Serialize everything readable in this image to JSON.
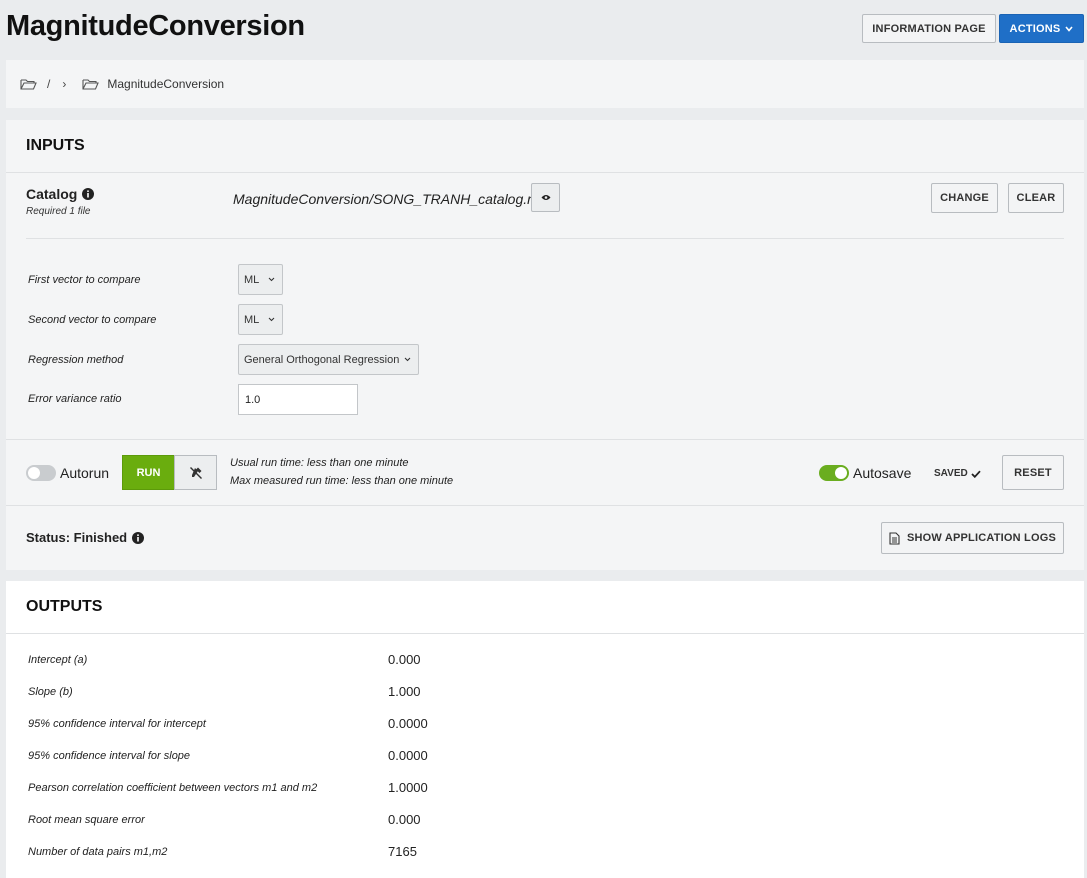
{
  "header": {
    "title": "MagnitudeConversion",
    "info_button": "INFORMATION PAGE",
    "actions_button": "ACTIONS"
  },
  "breadcrumb": {
    "root_sep": "/",
    "chevron": "›",
    "current": "MagnitudeConversion"
  },
  "inputs": {
    "title": "INPUTS",
    "catalog": {
      "label": "Catalog",
      "required": "Required 1 file",
      "path": "MagnitudeConversion/SONG_TRANH_catalog.mat",
      "change_button": "CHANGE",
      "clear_button": "CLEAR"
    },
    "params": [
      {
        "label": "First vector to compare",
        "value": "ML"
      },
      {
        "label": "Second vector to compare",
        "value": "ML"
      },
      {
        "label": "Regression method",
        "value": "General Orthogonal Regression"
      },
      {
        "label": "Error variance ratio",
        "value": "1.0"
      }
    ],
    "run": {
      "autorun_label": "Autorun",
      "autorun_on": false,
      "run_button": "RUN",
      "usual_time": "Usual run time: less than one minute",
      "max_time": "Max measured run time: less than one minute",
      "autosave_label": "Autosave",
      "autosave_on": true,
      "saved_label": "SAVED",
      "reset_button": "RESET"
    },
    "status": {
      "text": "Status: Finished",
      "logs_button": "SHOW APPLICATION LOGS"
    }
  },
  "outputs": {
    "title": "OUTPUTS",
    "rows": [
      {
        "label": "Intercept (a)",
        "value": "0.000"
      },
      {
        "label": "Slope (b)",
        "value": "1.000"
      },
      {
        "label": "95% confidence interval for intercept",
        "value": "0.0000"
      },
      {
        "label": "95% confidence interval for slope",
        "value": "0.0000"
      },
      {
        "label": "Pearson correlation coefficient between vectors m1 and m2",
        "value": "1.0000"
      },
      {
        "label": "Root mean square error",
        "value": "0.000"
      },
      {
        "label": "Number of data pairs m1,m2",
        "value": "7165"
      }
    ]
  },
  "colors": {
    "accent_blue": "#1f6fc7",
    "run_green": "#6aad0e",
    "toggle_green": "#6aad1f"
  }
}
